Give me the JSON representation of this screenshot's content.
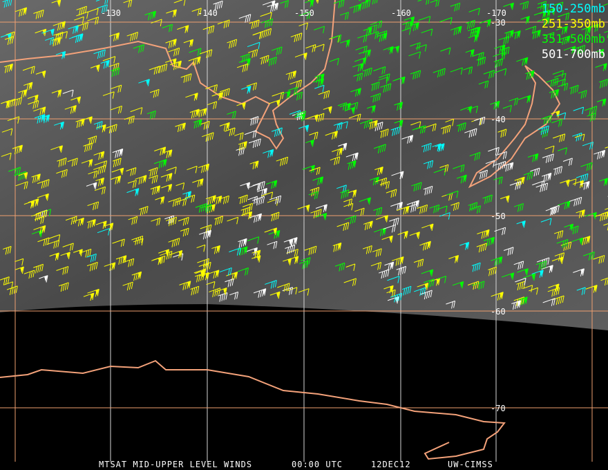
{
  "legend": [
    {
      "label": "150-250mb",
      "color": "#00ffff"
    },
    {
      "label": "251-350mb",
      "color": "#ffff00"
    },
    {
      "label": "351-500mb",
      "color": "#00ff00"
    },
    {
      "label": "501-700mb",
      "color": "#ffffff"
    }
  ],
  "longitude_labels": [
    "-130",
    "-140",
    "-150",
    "-160",
    "-170"
  ],
  "latitude_labels": [
    "-30",
    "-40",
    "-50",
    "-60",
    "-70"
  ],
  "caption": {
    "product": "MTSAT MID-UPPER LEVEL WINDS",
    "time": "00:00 UTC",
    "date": "12DEC12",
    "source": "UW-CIMSS"
  },
  "colors": {
    "grid_white": "#d8d8d8",
    "grid_orange": "#f0a070",
    "coast": "#f4a27a"
  }
}
